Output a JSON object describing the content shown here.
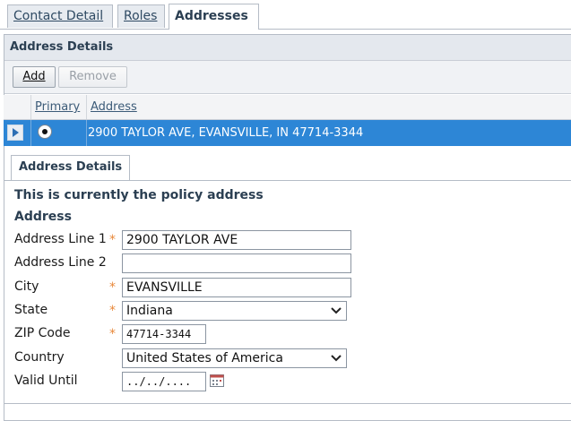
{
  "tabs": [
    {
      "label": "Contact Detail",
      "active": false
    },
    {
      "label": "Roles",
      "active": false
    },
    {
      "label": "Addresses",
      "active": true
    }
  ],
  "panel": {
    "title": "Address Details",
    "toolbar": {
      "add_label": "Add",
      "remove_label": "Remove"
    }
  },
  "grid": {
    "columns": [
      "Primary",
      "Address"
    ],
    "rows": [
      {
        "primary": true,
        "address": "2900 TAYLOR AVE, EVANSVILLE, IN 47714-3344",
        "selected": true
      }
    ]
  },
  "detail": {
    "tab_label": "Address Details",
    "policy_note": "This is currently the policy address",
    "section_title": "Address",
    "fields": {
      "address_line1": {
        "label": "Address Line 1",
        "value": "2900 TAYLOR AVE",
        "required": true
      },
      "address_line2": {
        "label": "Address Line 2",
        "value": "",
        "required": false
      },
      "city": {
        "label": "City",
        "value": "EVANSVILLE",
        "required": true
      },
      "state": {
        "label": "State",
        "value": "Indiana",
        "required": true
      },
      "zip": {
        "label": "ZIP Code",
        "value": "47714-3344",
        "required": true
      },
      "country": {
        "label": "Country",
        "value": "United States of America",
        "required": false
      },
      "valid_until": {
        "label": "Valid Until",
        "value": "../../...."
      }
    }
  },
  "colors": {
    "selection": "#2d86d6",
    "required": "#e8883a",
    "header_text": "#2b3f52"
  }
}
